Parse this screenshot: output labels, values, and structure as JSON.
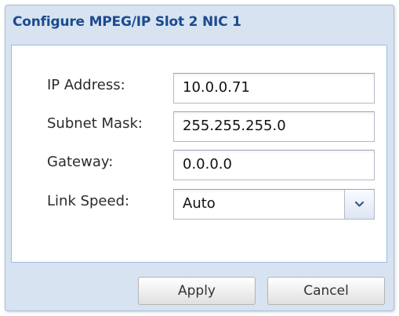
{
  "dialog": {
    "title": "Configure MPEG/IP Slot 2 NIC 1"
  },
  "form": {
    "ip_address": {
      "label": "IP Address:",
      "value": "10.0.0.71"
    },
    "subnet_mask": {
      "label": "Subnet Mask:",
      "value": "255.255.255.0"
    },
    "gateway": {
      "label": "Gateway:",
      "value": "0.0.0.0"
    },
    "link_speed": {
      "label": "Link Speed:",
      "value": "Auto"
    }
  },
  "buttons": {
    "apply": "Apply",
    "cancel": "Cancel"
  },
  "icons": {
    "combo_arrow": "chevron-down-icon"
  },
  "colors": {
    "title": "#1b4a8f",
    "dialog_background": "#d8e3f1",
    "panel_border": "#99bbe8",
    "arrow": "#3c5a85"
  }
}
